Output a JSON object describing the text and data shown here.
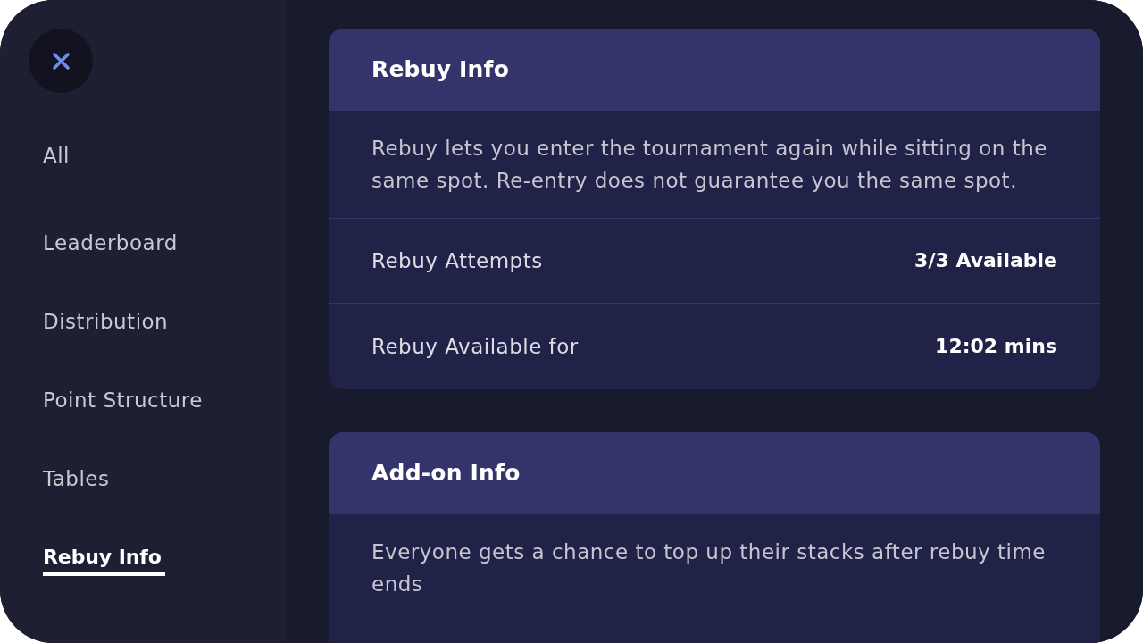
{
  "sidebar": {
    "items": [
      {
        "label": "All",
        "selected": false
      },
      {
        "label": "Leaderboard",
        "selected": false
      },
      {
        "label": "Distribution",
        "selected": false
      },
      {
        "label": "Point Structure",
        "selected": false
      },
      {
        "label": "Tables",
        "selected": false
      },
      {
        "label": "Rebuy Info",
        "selected": true
      }
    ]
  },
  "cards": [
    {
      "title": "Rebuy Info",
      "description": "Rebuy lets you enter the tournament again while sitting on the same spot. Re-entry does not guarantee you the same spot.",
      "rows": [
        {
          "label": "Rebuy Attempts",
          "value": "3/3 Available"
        },
        {
          "label": "Rebuy Available for",
          "value": "12:02 mins"
        }
      ]
    },
    {
      "title": "Add-on Info",
      "description": "Everyone gets a chance to top up their stacks after rebuy time ends"
    }
  ]
}
